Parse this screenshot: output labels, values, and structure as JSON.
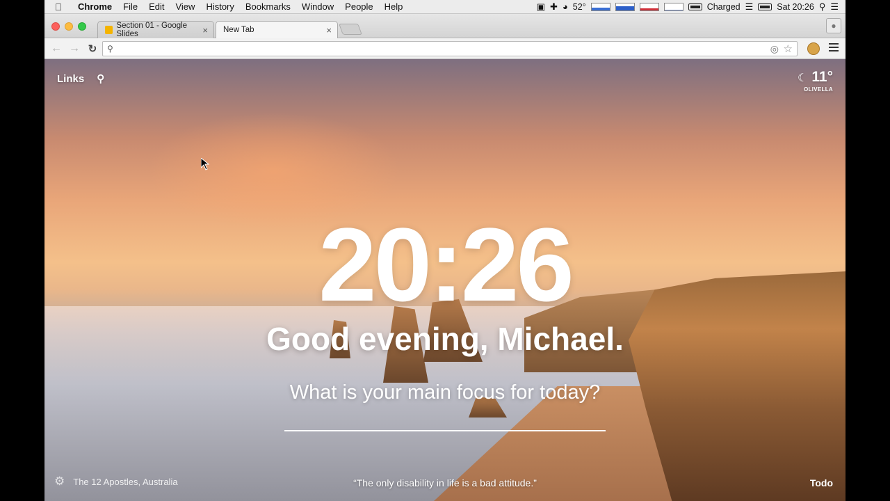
{
  "menubar": {
    "app_name": "Chrome",
    "items": [
      "File",
      "Edit",
      "View",
      "History",
      "Bookmarks",
      "Window",
      "People",
      "Help"
    ],
    "temperature": "52°",
    "battery_status": "Charged",
    "clock": "Sat 20:26"
  },
  "tabs": [
    {
      "label": "Section 01 - Google Slides",
      "icon": "google-slides-icon",
      "active": false
    },
    {
      "label": "New Tab",
      "active": true
    }
  ],
  "omnibox": {
    "value": "",
    "placeholder": ""
  },
  "newtab": {
    "links_label": "Links",
    "weather": {
      "temperature": "11°",
      "location": "OLIVELLA",
      "icon": "moon-icon"
    },
    "clock": "20:26",
    "greeting": "Good evening, Michael.",
    "focus_question": "What is your main focus for today?",
    "focus_value": "",
    "photo_location": "The 12 Apostles, Australia",
    "quote": "“The only disability in life is a bad attitude.”",
    "todo_label": "Todo"
  },
  "colors": {
    "traffic_close": "#fc605c",
    "traffic_min": "#fdbc40",
    "traffic_max": "#34c84a"
  }
}
